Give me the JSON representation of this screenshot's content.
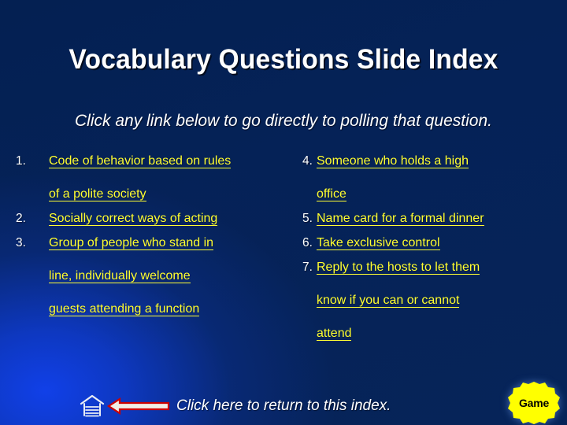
{
  "slide": {
    "title": "Vocabulary Questions Slide Index",
    "subtitle": "Click any link below to go directly to polling that question.",
    "background_top_color": "#052257",
    "background_glow_color": "#1140e8",
    "link_color": "#ffff33",
    "text_color": "#ffffff"
  },
  "left_column": [
    {
      "number": "1.",
      "lines": [
        "Code of behavior based on rules",
        "of a polite society"
      ]
    },
    {
      "number": "2.",
      "lines": [
        "Socially correct ways of acting"
      ]
    },
    {
      "number": "3.",
      "lines": [
        "Group of people who stand in",
        "line, individually welcome",
        "guests attending a function"
      ]
    }
  ],
  "right_column": [
    {
      "number": "4.",
      "lines": [
        "Someone who holds a high",
        "office"
      ]
    },
    {
      "number": "5.",
      "lines": [
        "Name card for a formal dinner"
      ]
    },
    {
      "number": "6.",
      "lines": [
        "Take exclusive control"
      ]
    },
    {
      "number": "7.",
      "lines": [
        "Reply to the hosts to let them",
        "know if you can or cannot",
        "attend"
      ]
    }
  ],
  "footer": {
    "home_icon": "home-icon",
    "arrow_icon": "left-arrow-icon",
    "arrow_fill": "#f2eee6",
    "arrow_stroke": "#cc0000",
    "return_text": "Click here to return to this index."
  },
  "badge": {
    "label": "Game",
    "fill": "#ffff00",
    "text_color": "#000000",
    "icon": "starburst-badge-icon"
  }
}
